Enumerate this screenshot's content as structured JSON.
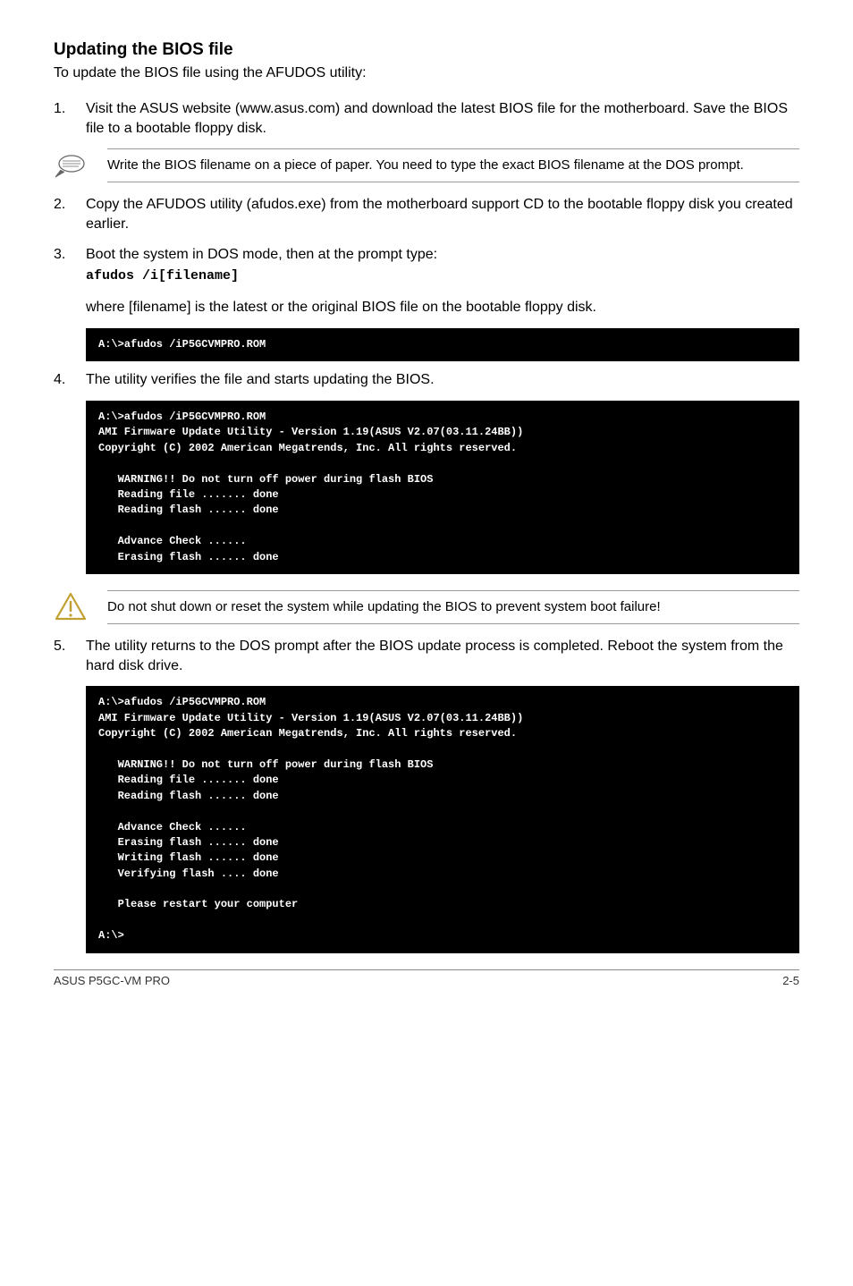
{
  "heading": "Updating the BIOS file",
  "intro": "To update the BIOS file using the AFUDOS utility:",
  "steps": {
    "s1": {
      "num": "1.",
      "text": "Visit the ASUS website (www.asus.com) and download the latest BIOS file for the motherboard. Save the BIOS file to a bootable floppy disk."
    },
    "s2": {
      "num": "2.",
      "text": "Copy the AFUDOS utility (afudos.exe) from the motherboard support CD to the bootable floppy disk you created earlier."
    },
    "s3": {
      "num": "3.",
      "text": "Boot the system in DOS mode, then at the prompt type:"
    },
    "s3_code": "afudos /i[filename]",
    "s3_note": "where [filename] is the latest or the original BIOS file on the bootable floppy disk.",
    "s4": {
      "num": "4.",
      "text": "The utility verifies the file and starts updating the BIOS."
    },
    "s5": {
      "num": "5.",
      "text": "The utility returns to the DOS prompt after the BIOS update process is completed. Reboot the system from the hard disk drive."
    }
  },
  "callouts": {
    "note1": "Write the BIOS filename on a piece of paper. You need to type the exact BIOS filename at the DOS prompt.",
    "warn1": "Do not shut down or reset the system while updating the BIOS to prevent system boot failure!"
  },
  "terminals": {
    "t1": "A:\\>afudos /iP5GCVMPRO.ROM",
    "t2": "A:\\>afudos /iP5GCVMPRO.ROM\nAMI Firmware Update Utility - Version 1.19(ASUS V2.07(03.11.24BB))\nCopyright (C) 2002 American Megatrends, Inc. All rights reserved.\n\n   WARNING!! Do not turn off power during flash BIOS\n   Reading file ....... done\n   Reading flash ...... done\n\n   Advance Check ......\n   Erasing flash ...... done",
    "t3": "A:\\>afudos /iP5GCVMPRO.ROM\nAMI Firmware Update Utility - Version 1.19(ASUS V2.07(03.11.24BB))\nCopyright (C) 2002 American Megatrends, Inc. All rights reserved.\n\n   WARNING!! Do not turn off power during flash BIOS\n   Reading file ....... done\n   Reading flash ...... done\n\n   Advance Check ......\n   Erasing flash ...... done\n   Writing flash ...... done\n   Verifying flash .... done\n\n   Please restart your computer\n\nA:\\>"
  },
  "footer": {
    "left": "ASUS P5GC-VM PRO",
    "right": "2-5"
  }
}
